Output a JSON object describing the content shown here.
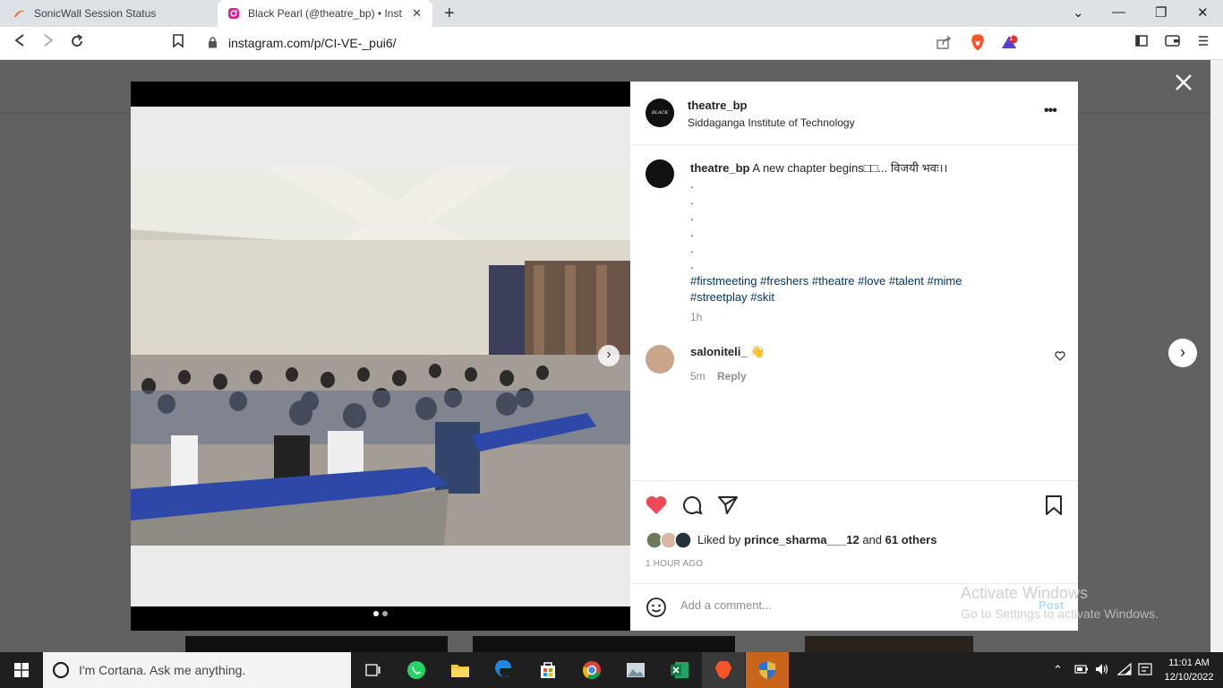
{
  "browser": {
    "tabs": [
      {
        "title": "SonicWall Session Status",
        "active": false
      },
      {
        "title": "Black Pearl (@theatre_bp) • Instagram",
        "active": true
      }
    ],
    "url": "instagram.com/p/CI-VE-_pui6/",
    "brave_badge": "1"
  },
  "post": {
    "username": "theatre_bp",
    "location": "Siddaganga Institute of Technology",
    "avatar_text": "BLACK PEARL",
    "caption_user": "theatre_bp",
    "caption_text": "A new chapter begins□□... विजयी भवः।।",
    "caption_dots": [
      ".",
      ".",
      ".",
      ".",
      ".",
      "."
    ],
    "hashtags_line1": "#firstmeeting #freshers #theatre #love #talent #mime",
    "hashtags_line2": "#streetplay #skit",
    "time": "1h",
    "comment": {
      "username": "saloniteli_",
      "emoji": "👋",
      "time": "5m",
      "reply_label": "Reply"
    },
    "liked_prefix": "Liked by",
    "liked_by": "prince_sharma___12",
    "liked_and": "and",
    "liked_others": "61 others",
    "posted_ago": "1 HOUR AGO",
    "comment_placeholder": "Add a comment...",
    "post_label": "Post"
  },
  "watermark": {
    "line1": "Activate Windows",
    "line2": "Go to Settings to activate Windows."
  },
  "taskbar": {
    "search_placeholder": "I'm Cortana. Ask me anything.",
    "time": "11:01 AM",
    "date": "12/10/2022"
  },
  "colors": {
    "like_red": "#ed4956",
    "link_blue": "#00376b",
    "taskbar": "#1f1f1f"
  }
}
